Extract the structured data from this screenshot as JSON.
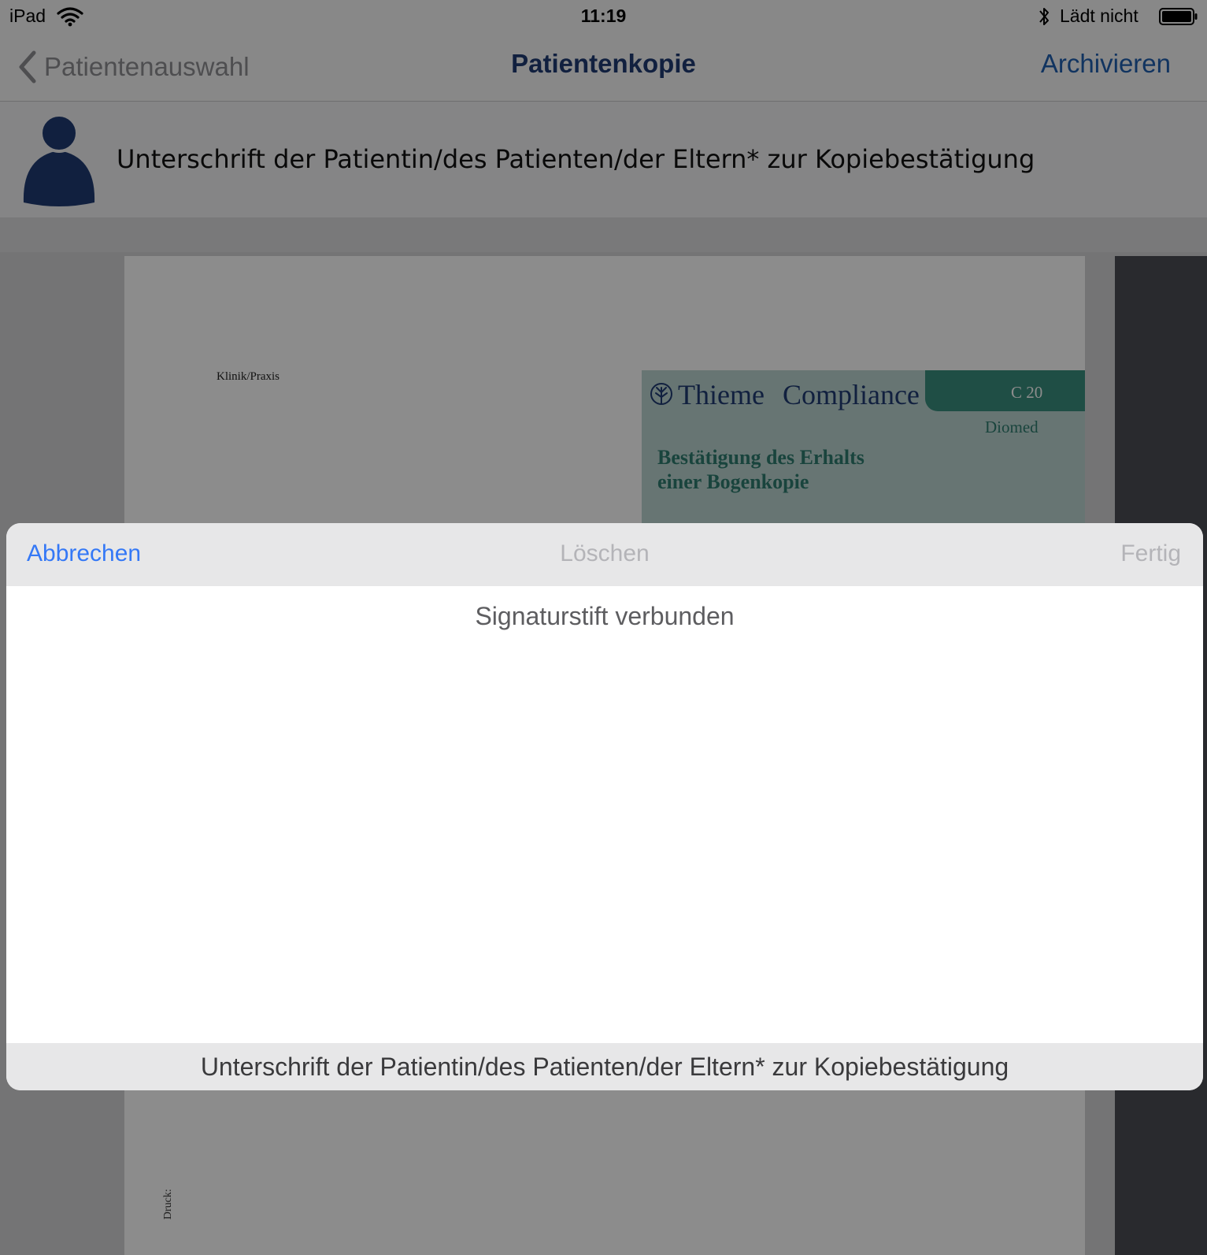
{
  "status_bar": {
    "device": "iPad",
    "time": "11:19",
    "charging_text": "Lädt nicht",
    "icons": {
      "wifi": "wifi-icon",
      "bluetooth": "bluetooth-icon",
      "battery": "battery-icon"
    },
    "battery_level": 1.0
  },
  "nav": {
    "back_label": "Patientenauswahl",
    "title": "Patientenkopie",
    "action_label": "Archivieren",
    "icons": {
      "back": "chevron-left-icon"
    }
  },
  "signature_header": {
    "label": "Unterschrift der Patientin/des Patienten/der Eltern* zur Kopiebestätigung",
    "icon": "person-icon"
  },
  "document": {
    "clinic_label": "Klinik/Praxis",
    "brand_left": "Thieme",
    "brand_right": "Compliance",
    "form_code": "C 20",
    "vendor": "Diomed",
    "title_line1": "Bestätigung des Erhalts",
    "title_line2": "einer Bogenkopie",
    "print_label": "Druck:",
    "icons": {
      "logo": "tree-logo-icon"
    }
  },
  "modal": {
    "cancel_label": "Abbrechen",
    "clear_label": "Löschen",
    "done_label": "Fertig",
    "status_text": "Signaturstift verbunden",
    "footer_label": "Unterschrift der Patientin/des Patienten/der Eltern* zur Kopiebestätigung"
  },
  "colors": {
    "nav_title": "#1f3b73",
    "nav_action": "#1f5fb0",
    "modal_accent": "#3478f6",
    "disabled": "#b4b4b8",
    "avatar": "#1f3b73",
    "form_teal": "#3a8f7f",
    "form_box": "#bcd6d1"
  }
}
